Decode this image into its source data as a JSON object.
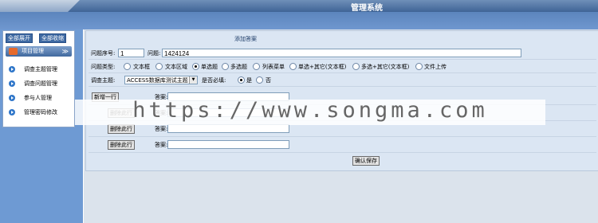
{
  "header": {
    "title": "管理系统"
  },
  "sidebar": {
    "expand_all": "全部展开",
    "collapse_all": "全部收缩",
    "section": {
      "label": "项目管理",
      "arrow": "≫"
    },
    "items": [
      {
        "label": "调查主题管理"
      },
      {
        "label": "调查问题管理"
      },
      {
        "label": "参与人管理"
      },
      {
        "label": "管理密码修改"
      }
    ]
  },
  "form": {
    "title": "添加答案",
    "seq_label": "问题序号:",
    "seq_value": "1",
    "question_label": "问题:",
    "question_value": "1424124",
    "type_label": "问题类型:",
    "types": [
      {
        "label": "文本框",
        "selected": false
      },
      {
        "label": "文本区域",
        "selected": false
      },
      {
        "label": "单选题",
        "selected": true
      },
      {
        "label": "多选题",
        "selected": false
      },
      {
        "label": "列表菜单",
        "selected": false
      },
      {
        "label": "单选+其它(文本框)",
        "selected": false
      },
      {
        "label": "多选+其它(文本框)",
        "selected": false
      },
      {
        "label": "文件上传",
        "selected": false
      }
    ],
    "topic_label": "调查主题:",
    "topic_value": "ACCESS数据库测试主题",
    "required_label": "是否必填:",
    "required_options": [
      {
        "label": "是",
        "selected": true
      },
      {
        "label": "否",
        "selected": false
      }
    ],
    "add_row_button": "新增一行",
    "delete_row_button": "删除此行",
    "answer_label": "答案:",
    "answers": [
      "",
      "",
      "",
      ""
    ],
    "submit_button": "确认保存"
  },
  "watermark": "https://www.songma.com"
}
